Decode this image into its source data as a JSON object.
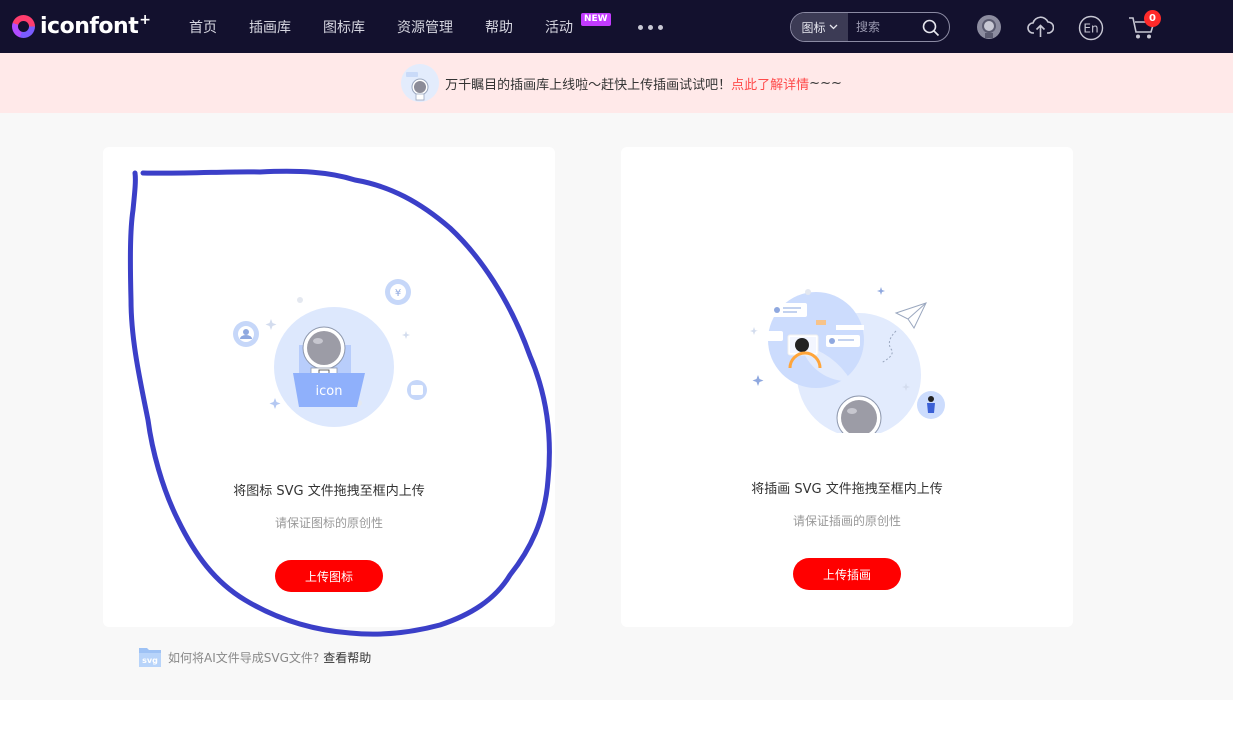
{
  "brand": {
    "name": "iconfont",
    "suffix": "+"
  },
  "nav": {
    "items": [
      {
        "label": "首页"
      },
      {
        "label": "插画库"
      },
      {
        "label": "图标库"
      },
      {
        "label": "资源管理"
      },
      {
        "label": "帮助"
      },
      {
        "label": "活动",
        "badge": "NEW"
      }
    ],
    "search": {
      "type_label": "图标",
      "placeholder": "搜索"
    },
    "lang_label": "En",
    "cart_count": "0"
  },
  "banner": {
    "text": "万千瞩目的插画库上线啦～赶快上传插画试试吧！",
    "link": "点此了解详情",
    "tail": "~~~"
  },
  "cards": {
    "icon": {
      "illus_label": "icon",
      "title": "将图标 SVG 文件拖拽至框内上传",
      "subtitle": "请保证图标的原创性",
      "button": "上传图标"
    },
    "illustration": {
      "title": "将插画 SVG 文件拖拽至框内上传",
      "subtitle": "请保证插画的原创性",
      "button": "上传插画"
    }
  },
  "help": {
    "badge": "svg",
    "text": "如何将AI文件导成SVG文件?",
    "link": "查看帮助"
  },
  "colors": {
    "nav_bg": "#13112e",
    "banner_bg": "#ffe9e9",
    "accent_red": "#ff0000",
    "link_red": "#ff4b4b",
    "annotation_stroke": "#3b3fc8"
  },
  "icons": [
    "logo-mark",
    "search-icon",
    "chevron-down-icon",
    "avatar-icon",
    "upload-cloud-icon",
    "language-icon",
    "cart-icon",
    "svg-file-icon"
  ]
}
